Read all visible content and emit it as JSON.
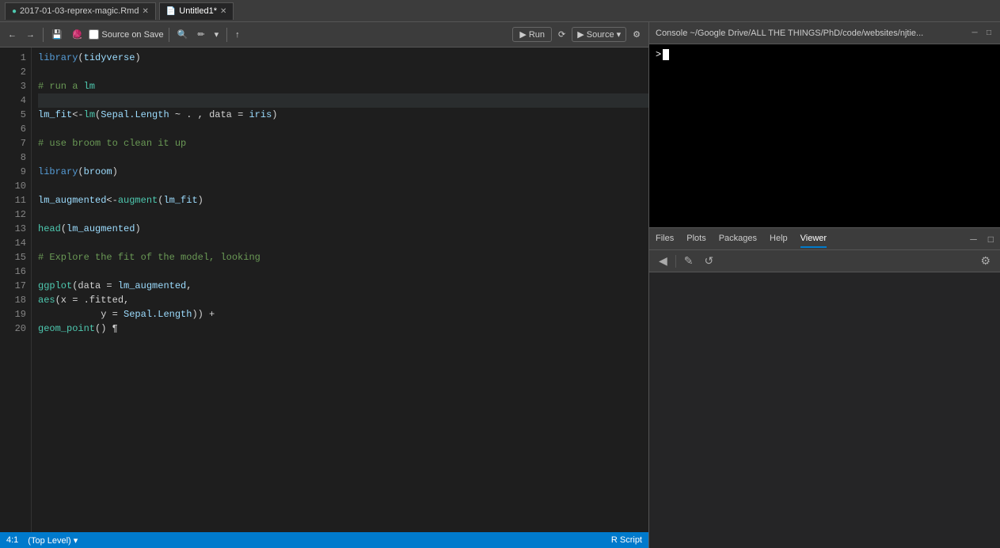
{
  "titleBar": {
    "tab1": {
      "label": "2017-01-03-reprex-magic.Rmd",
      "active": false,
      "icon": "📄"
    },
    "tab2": {
      "label": "Untitled1*",
      "active": true,
      "icon": "📄"
    }
  },
  "toolbar": {
    "undo_label": "↩",
    "redo_label": "↪",
    "save_icon": "💾",
    "source_on_save_label": "Source on Save",
    "search_icon": "🔍",
    "format_icon": "✏",
    "run_label": "Run",
    "rerun_icon": "↻",
    "source_label": "Source",
    "source_dropdown": "▾",
    "publish_icon": "↑"
  },
  "codeLines": [
    {
      "num": 1,
      "content": "library(tidyverse)",
      "active": false
    },
    {
      "num": 2,
      "content": "",
      "active": false
    },
    {
      "num": 3,
      "content": "# run a lm",
      "active": false
    },
    {
      "num": 4,
      "content": "",
      "active": true
    },
    {
      "num": 5,
      "content": "lm_fit <- lm(Sepal.Length ~ . , data = iris)",
      "active": false
    },
    {
      "num": 6,
      "content": "",
      "active": false
    },
    {
      "num": 7,
      "content": "# use broom to clean it up",
      "active": false
    },
    {
      "num": 8,
      "content": "",
      "active": false
    },
    {
      "num": 9,
      "content": "library(broom)",
      "active": false
    },
    {
      "num": 10,
      "content": "",
      "active": false
    },
    {
      "num": 11,
      "content": "lm_augmented <- augment(lm_fit)",
      "active": false
    },
    {
      "num": 12,
      "content": "",
      "active": false
    },
    {
      "num": 13,
      "content": "head(lm_augmented)",
      "active": false
    },
    {
      "num": 14,
      "content": "",
      "active": false
    },
    {
      "num": 15,
      "content": "# Explore the fit of the model, looking",
      "active": false
    },
    {
      "num": 16,
      "content": "",
      "active": false
    },
    {
      "num": 17,
      "content": "ggplot(data = lm_augmented,",
      "active": false
    },
    {
      "num": 18,
      "content": "       aes(x = .fitted,",
      "active": false
    },
    {
      "num": 19,
      "content": "           y = Sepal.Length)) +",
      "active": false
    },
    {
      "num": 20,
      "content": "  geom_point() ¶",
      "active": false
    }
  ],
  "statusBar": {
    "position": "4:1",
    "scope": "(Top Level)",
    "fileType": "R Script"
  },
  "consoleTitle": "Console ~/Google Drive/ALL THE THINGS/PhD/code/websites/njtie...",
  "panelTabs": {
    "tabs": [
      "Files",
      "Plots",
      "Packages",
      "Help",
      "Viewer"
    ],
    "active": "Viewer"
  }
}
